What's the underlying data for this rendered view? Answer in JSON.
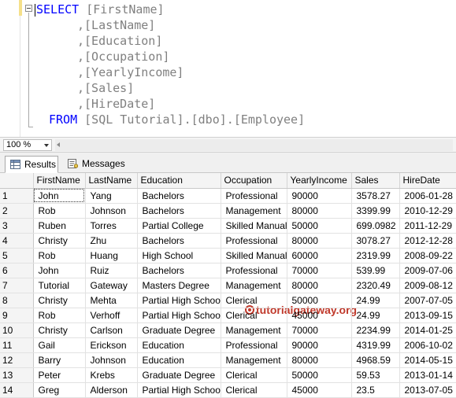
{
  "editor": {
    "lines": [
      {
        "kw": "SELECT",
        "prefix": "",
        "text": "[FirstName]"
      },
      {
        "kw": "",
        "prefix": ",",
        "text": "[LastName]"
      },
      {
        "kw": "",
        "prefix": ",",
        "text": "[Education]"
      },
      {
        "kw": "",
        "prefix": ",",
        "text": "[Occupation]"
      },
      {
        "kw": "",
        "prefix": ",",
        "text": "[YearlyIncome]"
      },
      {
        "kw": "",
        "prefix": ",",
        "text": "[Sales]"
      },
      {
        "kw": "",
        "prefix": ",",
        "text": "[HireDate]"
      }
    ],
    "from_kw": "FROM",
    "from_parts": [
      "[SQL Tutorial]",
      ".",
      "[dbo]",
      ".",
      "[Employee]"
    ]
  },
  "zoom": {
    "value": "100 %"
  },
  "tabs": {
    "results": "Results",
    "messages": "Messages"
  },
  "watermark": "tutorialgateway.org",
  "colors": {
    "keyword": "#0000ff",
    "punct": "#808080",
    "watermark": "#c0392b"
  },
  "grid": {
    "columns": [
      "FirstName",
      "LastName",
      "Education",
      "Occupation",
      "YearlyIncome",
      "Sales",
      "HireDate"
    ],
    "rows": [
      [
        "1",
        "John",
        "Yang",
        "Bachelors",
        "Professional",
        "90000",
        "3578.27",
        "2006-01-28"
      ],
      [
        "2",
        "Rob",
        "Johnson",
        "Bachelors",
        "Management",
        "80000",
        "3399.99",
        "2010-12-29"
      ],
      [
        "3",
        "Ruben",
        "Torres",
        "Partial College",
        "Skilled Manual",
        "50000",
        "699.0982",
        "2011-12-29"
      ],
      [
        "4",
        "Christy",
        "Zhu",
        "Bachelors",
        "Professional",
        "80000",
        "3078.27",
        "2012-12-28"
      ],
      [
        "5",
        "Rob",
        "Huang",
        "High School",
        "Skilled Manual",
        "60000",
        "2319.99",
        "2008-09-22"
      ],
      [
        "6",
        "John",
        "Ruiz",
        "Bachelors",
        "Professional",
        "70000",
        "539.99",
        "2009-07-06"
      ],
      [
        "7",
        "Tutorial",
        "Gateway",
        "Masters Degree",
        "Management",
        "80000",
        "2320.49",
        "2009-08-12"
      ],
      [
        "8",
        "Christy",
        "Mehta",
        "Partial High School",
        "Clerical",
        "50000",
        "24.99",
        "2007-07-05"
      ],
      [
        "9",
        "Rob",
        "Verhoff",
        "Partial High School",
        "Clerical",
        "45000",
        "24.99",
        "2013-09-15"
      ],
      [
        "10",
        "Christy",
        "Carlson",
        "Graduate Degree",
        "Management",
        "70000",
        "2234.99",
        "2014-01-25"
      ],
      [
        "11",
        "Gail",
        "Erickson",
        "Education",
        "Professional",
        "90000",
        "4319.99",
        "2006-10-02"
      ],
      [
        "12",
        "Barry",
        "Johnson",
        "Education",
        "Management",
        "80000",
        "4968.59",
        "2014-05-15"
      ],
      [
        "13",
        "Peter",
        "Krebs",
        "Graduate Degree",
        "Clerical",
        "50000",
        "59.53",
        "2013-01-14"
      ],
      [
        "14",
        "Greg",
        "Alderson",
        "Partial High School",
        "Clerical",
        "45000",
        "23.5",
        "2013-07-05"
      ]
    ]
  }
}
